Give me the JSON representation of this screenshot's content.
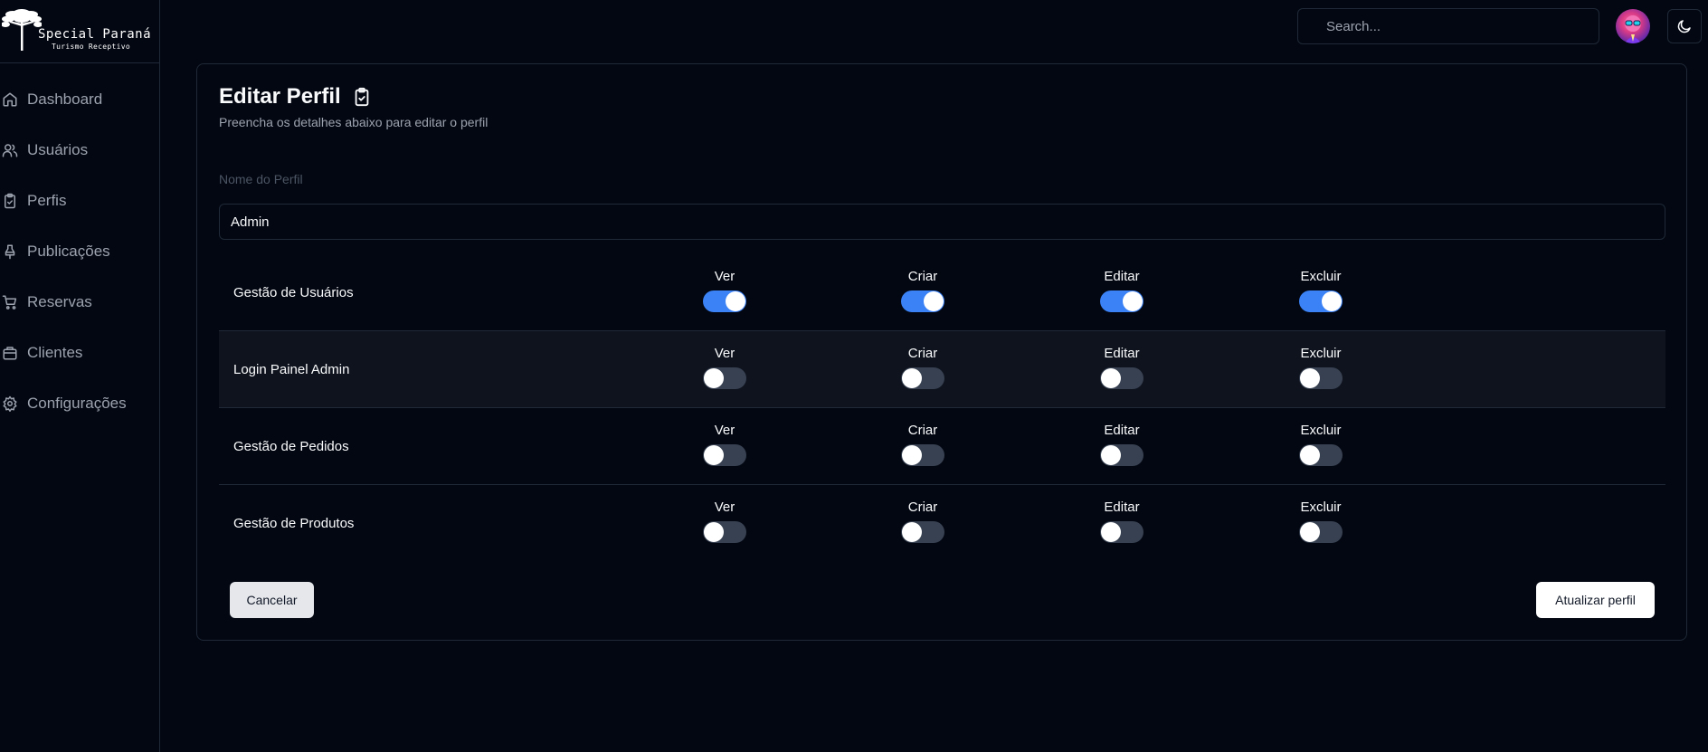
{
  "brand": {
    "name": "Special Paraná",
    "subtitle": "Turismo Receptivo"
  },
  "sidebar": {
    "items": [
      {
        "label": "Dashboard",
        "icon": "home-icon"
      },
      {
        "label": "Usuários",
        "icon": "users-icon"
      },
      {
        "label": "Perfis",
        "icon": "clipboard-check-icon"
      },
      {
        "label": "Publicações",
        "icon": "pin-icon"
      },
      {
        "label": "Reservas",
        "icon": "cart-icon"
      },
      {
        "label": "Clientes",
        "icon": "box-icon"
      },
      {
        "label": "Configurações",
        "icon": "gear-icon"
      }
    ]
  },
  "topbar": {
    "search_placeholder": "Search...",
    "theme_icon": "moon-icon"
  },
  "page": {
    "title": "Editar Perfil",
    "description": "Preencha os detalhes abaixo para editar o perfil",
    "field_label": "Nome do Perfil",
    "field_value": "Admin"
  },
  "permissions": {
    "columns": [
      "Ver",
      "Criar",
      "Editar",
      "Excluir"
    ],
    "rows": [
      {
        "name": "Gestão de Usuários",
        "values": [
          true,
          true,
          true,
          true
        ]
      },
      {
        "name": "Login Painel Admin",
        "values": [
          false,
          false,
          false,
          false
        ]
      },
      {
        "name": "Gestão de Pedidos",
        "values": [
          false,
          false,
          false,
          false
        ]
      },
      {
        "name": "Gestão de Produtos",
        "values": [
          false,
          false,
          false,
          false
        ]
      }
    ]
  },
  "actions": {
    "cancel": "Cancelar",
    "update": "Atualizar perfil"
  },
  "colors": {
    "background": "#030712",
    "toggle_on": "#3b82f6",
    "toggle_off": "#374151",
    "border": "#1f2937"
  }
}
